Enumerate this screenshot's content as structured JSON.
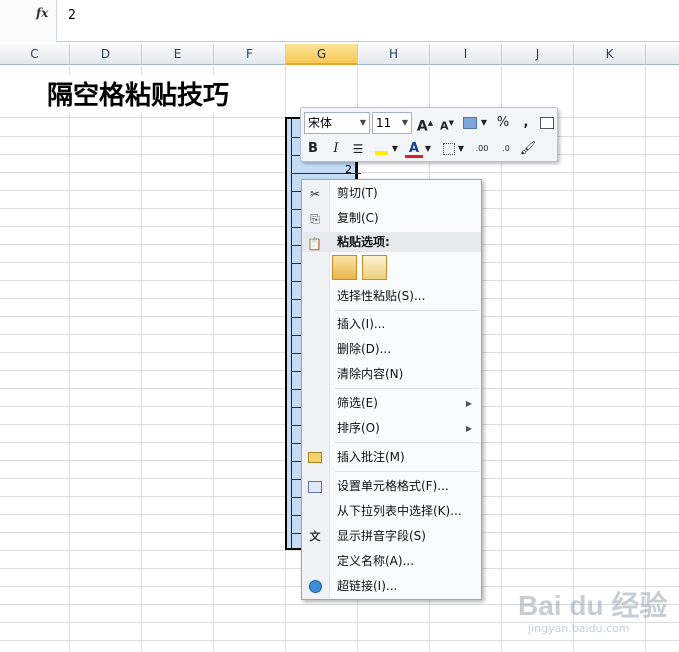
{
  "formula_bar": {
    "fx_label": "fx",
    "value": "2"
  },
  "columns": [
    {
      "label": "C",
      "active": false
    },
    {
      "label": "D",
      "active": false
    },
    {
      "label": "E",
      "active": false
    },
    {
      "label": "F",
      "active": false
    },
    {
      "label": "G",
      "active": true
    },
    {
      "label": "H",
      "active": false
    },
    {
      "label": "I",
      "active": false
    },
    {
      "label": "J",
      "active": false
    },
    {
      "label": "K",
      "active": false
    }
  ],
  "sheet": {
    "title": "隔空格粘贴技巧",
    "cell_value": "2"
  },
  "mini_toolbar": {
    "font_name": "宋体",
    "font_size": "11",
    "buttons": {
      "grow_font": "A",
      "shrink_font": "A",
      "percent": "%",
      "comma": ",",
      "bold": "B",
      "italic": "I",
      "font_color": "A",
      "inc_decimal": ".00",
      "dec_decimal": ".0"
    }
  },
  "context_menu": {
    "cut": "剪切(T)",
    "copy": "复制(C)",
    "paste_options_header": "粘贴选项:",
    "paste_special": "选择性粘贴(S)...",
    "insert": "插入(I)...",
    "delete": "删除(D)...",
    "clear_contents": "清除内容(N)",
    "filter": "筛选(E)",
    "sort": "排序(O)",
    "insert_comment": "插入批注(M)",
    "format_cells": "设置单元格格式(F)...",
    "pick_from_list": "从下拉列表中选择(K)...",
    "show_phonetic": "显示拼音字段(S)",
    "define_name": "定义名称(A)...",
    "hyperlink": "超链接(I)..."
  },
  "watermark": {
    "brand": "Bai du 经验",
    "url": "jingyan.baidu.com"
  },
  "colors": {
    "accent": "#f7c955",
    "selection": "#c5dcf5",
    "header_text": "#27415f"
  }
}
